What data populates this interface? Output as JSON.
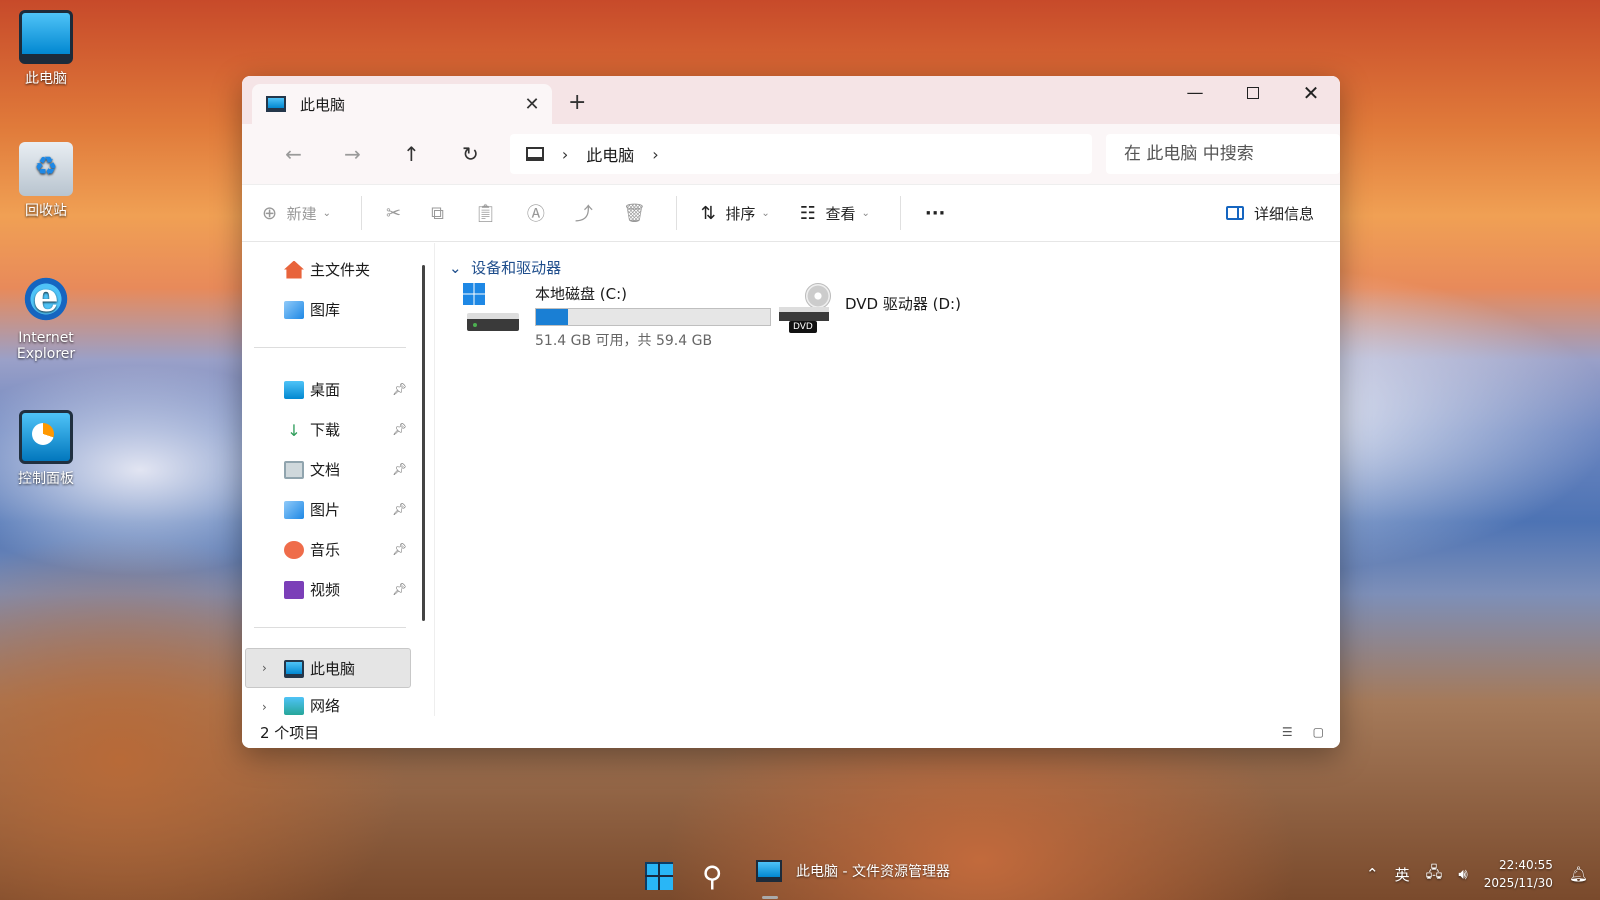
{
  "desktop": {
    "icons": [
      {
        "label": "此电脑",
        "icon": "computer-icon"
      },
      {
        "label": "回收站",
        "icon": "recycle-bin-icon"
      },
      {
        "label": "Internet Explorer",
        "icon": "internet-explorer-icon"
      },
      {
        "label": "控制面板",
        "icon": "control-panel-icon"
      }
    ]
  },
  "window": {
    "tab_title": "此电脑",
    "address": {
      "crumb": "此电脑"
    },
    "search": {
      "placeholder": "在 此电脑 中搜索"
    },
    "toolbar": {
      "new_label": "新建",
      "sort_label": "排序",
      "view_label": "查看",
      "more_label": "···",
      "details_label": "详细信息"
    },
    "sidebar": {
      "quick": [
        {
          "label": "主文件夹",
          "icon": "home-icon",
          "color": "#e8643c"
        },
        {
          "label": "图库",
          "icon": "gallery-icon",
          "color": "#1e88e5"
        }
      ],
      "pinned": [
        {
          "label": "桌面",
          "icon": "desktop-icon",
          "color": "#29b6f6"
        },
        {
          "label": "下载",
          "icon": "download-icon",
          "color": "#2e9d5a"
        },
        {
          "label": "文档",
          "icon": "documents-icon",
          "color": "#90a4ae"
        },
        {
          "label": "图片",
          "icon": "pictures-icon",
          "color": "#1e88e5"
        },
        {
          "label": "音乐",
          "icon": "music-icon",
          "color": "#ef6c4a"
        },
        {
          "label": "视频",
          "icon": "videos-icon",
          "color": "#7b3fb8"
        }
      ],
      "this_pc": "此电脑",
      "network": "网络"
    },
    "content": {
      "group_header": "设备和驱动器",
      "drives": [
        {
          "name": "本地磁盘 (C:)",
          "free_text": "51.4 GB 可用，共 59.4 GB",
          "used_fraction": 0.135
        },
        {
          "name": "DVD 驱动器 (D:)",
          "badge": "DVD"
        }
      ]
    },
    "status": {
      "item_count": "2 个项目"
    }
  },
  "taskbar": {
    "app_label": "此电脑 - 文件资源管理器",
    "ime": "英",
    "time": "22:40:55",
    "date": "2025/11/30"
  }
}
